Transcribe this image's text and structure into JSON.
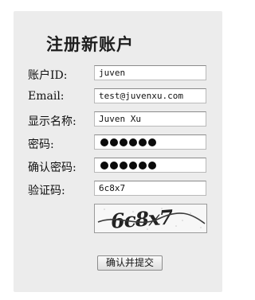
{
  "form": {
    "title": "注册新账户",
    "fields": [
      {
        "label": "账户ID:",
        "value": "juven"
      },
      {
        "label": "Email:",
        "value": "test@juvenxu.com"
      },
      {
        "label": "显示名称:",
        "value": "Juven Xu"
      },
      {
        "label": "密码:",
        "value": "●●●●●●",
        "masked": true
      },
      {
        "label": "确认密码:",
        "value": "●●●●●●",
        "masked": true
      },
      {
        "label": "验证码:",
        "value": "6c8x7"
      }
    ],
    "captcha": {
      "text": "6c8x7"
    },
    "submit_label": "确认并提交"
  }
}
